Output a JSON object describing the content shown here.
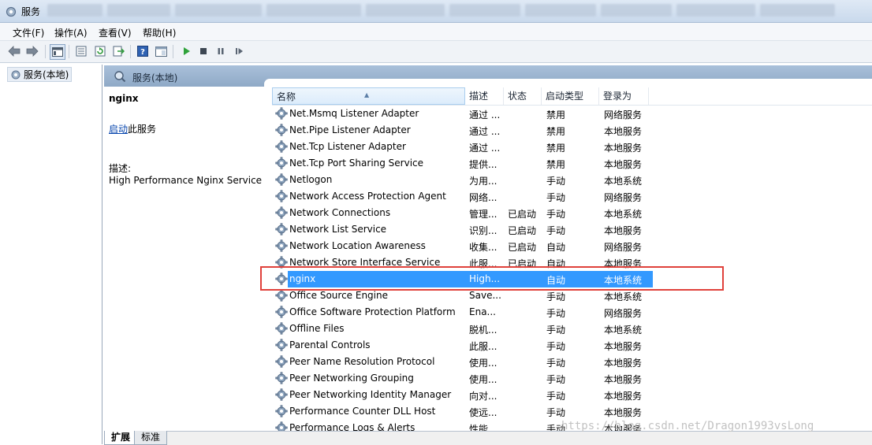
{
  "window": {
    "title": "服务"
  },
  "menu": [
    "文件(F)",
    "操作(A)",
    "查看(V)",
    "帮助(H)"
  ],
  "toolbar": {
    "buttons": [
      "back-icon",
      "forward-icon",
      "console-tree-icon",
      "properties-icon",
      "refresh-icon",
      "export-list-icon",
      "help-icon",
      "show-hide-icon",
      "start-service-icon",
      "stop-service-icon",
      "pause-service-icon",
      "resume-service-icon"
    ]
  },
  "tree": {
    "node": "服务(本地)"
  },
  "panel": {
    "header": "服务(本地)"
  },
  "details": {
    "service_name": "nginx",
    "start_link": "启动",
    "start_suffix": "此服务",
    "desc_label": "描述:",
    "description": "High Performance Nginx Service"
  },
  "columns": [
    "名称",
    "描述",
    "状态",
    "启动类型",
    "登录为"
  ],
  "rows": [
    {
      "name": "Net.Msmq Listener Adapter",
      "desc": "通过 ...",
      "status": "",
      "startup": "禁用",
      "logon": "网络服务"
    },
    {
      "name": "Net.Pipe Listener Adapter",
      "desc": "通过 ...",
      "status": "",
      "startup": "禁用",
      "logon": "本地服务"
    },
    {
      "name": "Net.Tcp Listener Adapter",
      "desc": "通过 ...",
      "status": "",
      "startup": "禁用",
      "logon": "本地服务"
    },
    {
      "name": "Net.Tcp Port Sharing Service",
      "desc": "提供...",
      "status": "",
      "startup": "禁用",
      "logon": "本地服务"
    },
    {
      "name": "Netlogon",
      "desc": "为用...",
      "status": "",
      "startup": "手动",
      "logon": "本地系统"
    },
    {
      "name": "Network Access Protection Agent",
      "desc": "网络...",
      "status": "",
      "startup": "手动",
      "logon": "网络服务"
    },
    {
      "name": "Network Connections",
      "desc": "管理...",
      "status": "已启动",
      "startup": "手动",
      "logon": "本地系统"
    },
    {
      "name": "Network List Service",
      "desc": "识别...",
      "status": "已启动",
      "startup": "手动",
      "logon": "本地服务"
    },
    {
      "name": "Network Location Awareness",
      "desc": "收集...",
      "status": "已启动",
      "startup": "自动",
      "logon": "网络服务"
    },
    {
      "name": "Network Store Interface Service",
      "desc": "此服...",
      "status": "已启动",
      "startup": "自动",
      "logon": "本地服务"
    },
    {
      "name": "nginx",
      "desc": "High...",
      "status": "",
      "startup": "自动",
      "logon": "本地系统"
    },
    {
      "name": "Office  Source Engine",
      "desc": "Save...",
      "status": "",
      "startup": "手动",
      "logon": "本地系统"
    },
    {
      "name": "Office Software Protection Platform",
      "desc": "Ena...",
      "status": "",
      "startup": "手动",
      "logon": "网络服务"
    },
    {
      "name": "Offline Files",
      "desc": "脱机...",
      "status": "",
      "startup": "手动",
      "logon": "本地系统"
    },
    {
      "name": "Parental Controls",
      "desc": "此服...",
      "status": "",
      "startup": "手动",
      "logon": "本地服务"
    },
    {
      "name": "Peer Name Resolution Protocol",
      "desc": "使用...",
      "status": "",
      "startup": "手动",
      "logon": "本地服务"
    },
    {
      "name": "Peer Networking Grouping",
      "desc": "使用...",
      "status": "",
      "startup": "手动",
      "logon": "本地服务"
    },
    {
      "name": "Peer Networking Identity Manager",
      "desc": "向对...",
      "status": "",
      "startup": "手动",
      "logon": "本地服务"
    },
    {
      "name": "Performance Counter DLL Host",
      "desc": "使远...",
      "status": "",
      "startup": "手动",
      "logon": "本地服务"
    },
    {
      "name": "Performance Logs & Alerts",
      "desc": "性能...",
      "status": "",
      "startup": "手动",
      "logon": "本地服务"
    }
  ],
  "selected_row": 10,
  "tabs": [
    "扩展",
    "标准"
  ],
  "watermark": "https://blog.csdn.net/Dragon1993vsLong",
  "colors": {
    "selection": "#3399ff",
    "highlight_box": "#e0413b",
    "header": "#a9c0da"
  }
}
